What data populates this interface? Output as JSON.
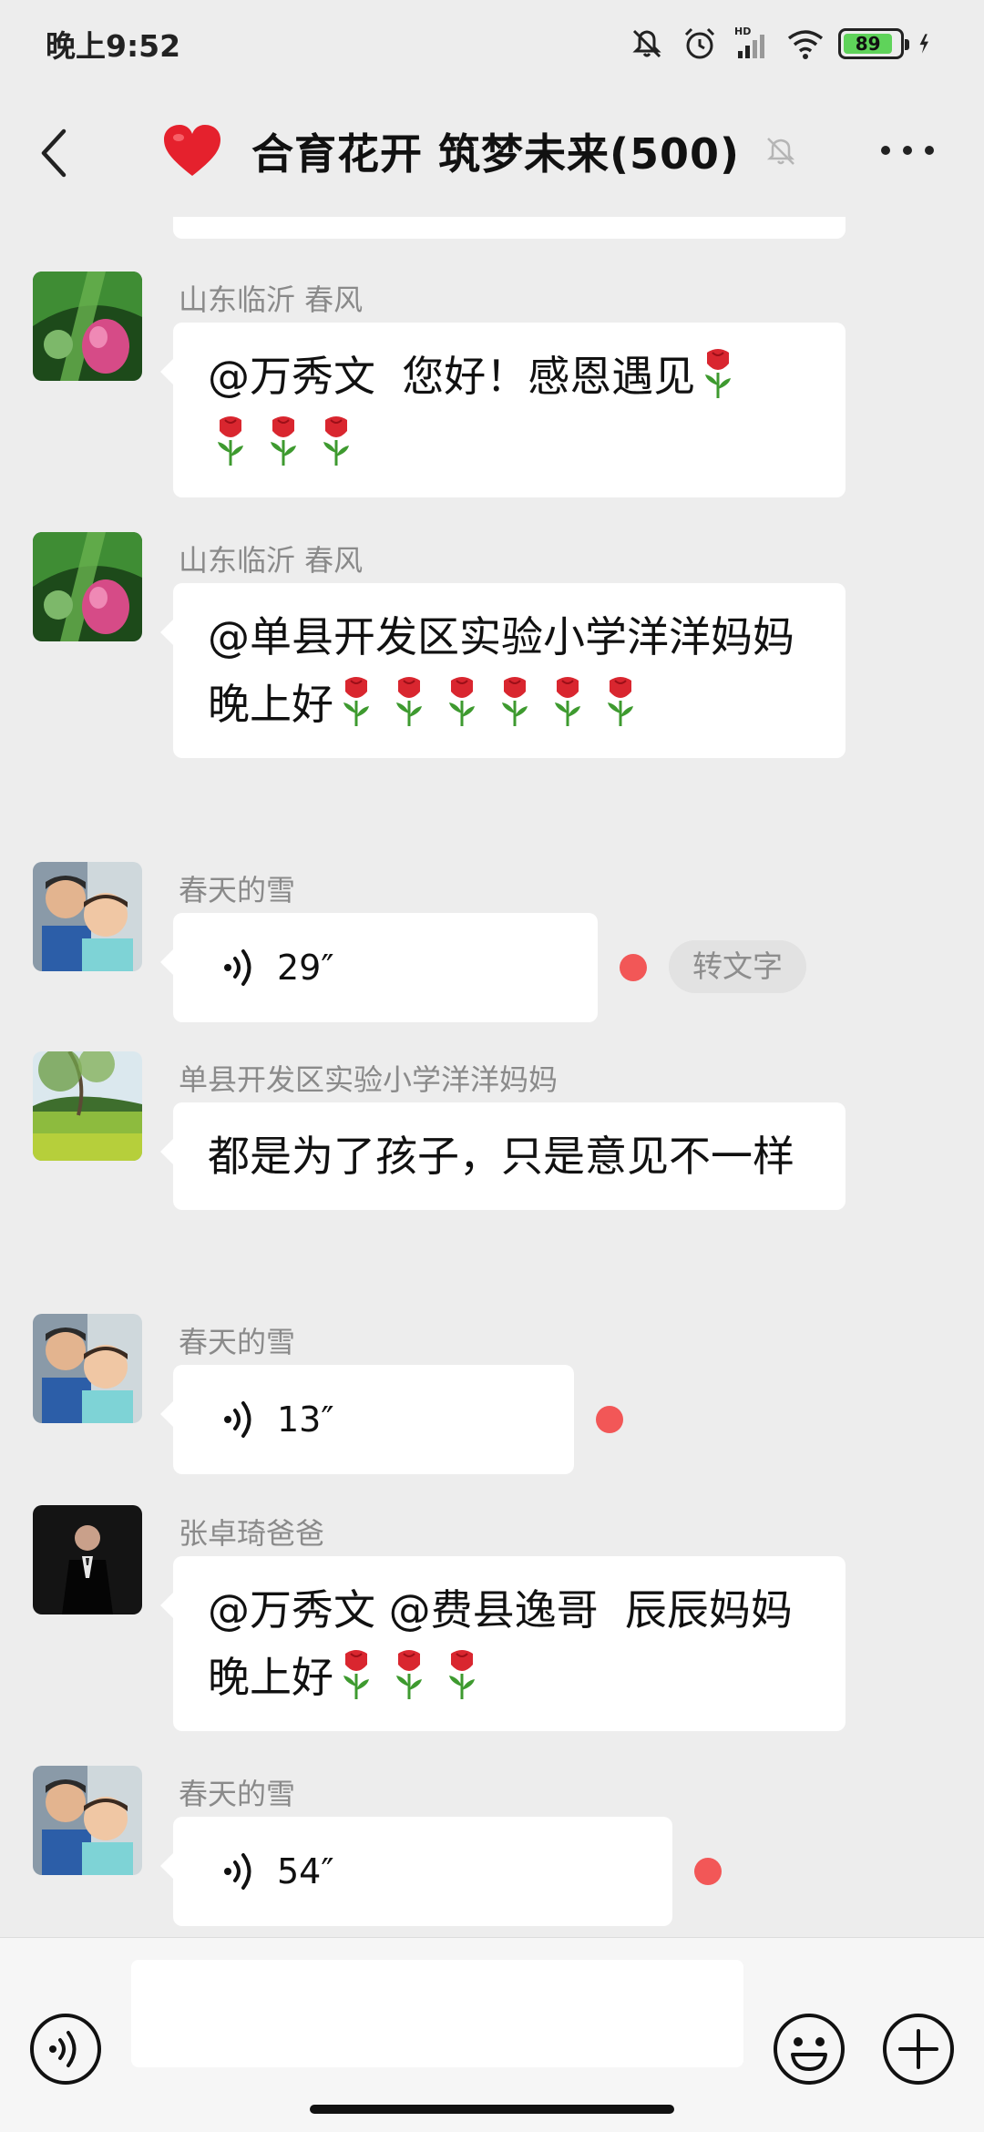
{
  "status_bar": {
    "time": "晚上9:52",
    "battery": "89",
    "icons": [
      "mute-icon",
      "alarm-icon",
      "hd-signal-icon",
      "wifi-icon",
      "battery-icon",
      "charging-icon"
    ]
  },
  "header": {
    "title": "合育花开 筑梦未来(500)",
    "icons": [
      "back-arrow-icon",
      "red-heart-icon",
      "muted-bell-icon",
      "more-dots-icon"
    ]
  },
  "messages": [
    {
      "sender": "山东临沂  春风",
      "type": "text",
      "text": "@万秀文  您好！感恩遇见",
      "roses_inline": 1,
      "text2": "",
      "roses_line2": 3
    },
    {
      "sender": "山东临沂  春风",
      "type": "text",
      "text": "@单县开发区实验小学洋洋妈妈",
      "text2": "晚上好",
      "roses_line2": 6
    },
    {
      "sender": "春天的雪",
      "type": "voice",
      "duration": "29″",
      "unread": true,
      "to_text_label": "转文字"
    },
    {
      "sender": "单县开发区实验小学洋洋妈妈",
      "type": "text",
      "text": "都是为了孩子，只是意见不一样"
    },
    {
      "sender": "春天的雪",
      "type": "voice",
      "duration": "13″",
      "unread": true
    },
    {
      "sender": "张卓琦爸爸",
      "type": "text",
      "text": "@万秀文 @费县逸哥  辰辰妈妈   晚上好",
      "roses_inline": 3
    },
    {
      "sender": "春天的雪",
      "type": "voice",
      "duration": "54″",
      "unread": true
    }
  ],
  "input_bar": {
    "placeholder": "",
    "icons": [
      "voice-toggle-icon",
      "emoji-icon",
      "plus-icon"
    ]
  },
  "colors": {
    "background": "#ededed",
    "bubble": "#ffffff",
    "sender_name": "#8a8a8a",
    "unread_dot": "#f25757",
    "heart": "#e5212d"
  }
}
